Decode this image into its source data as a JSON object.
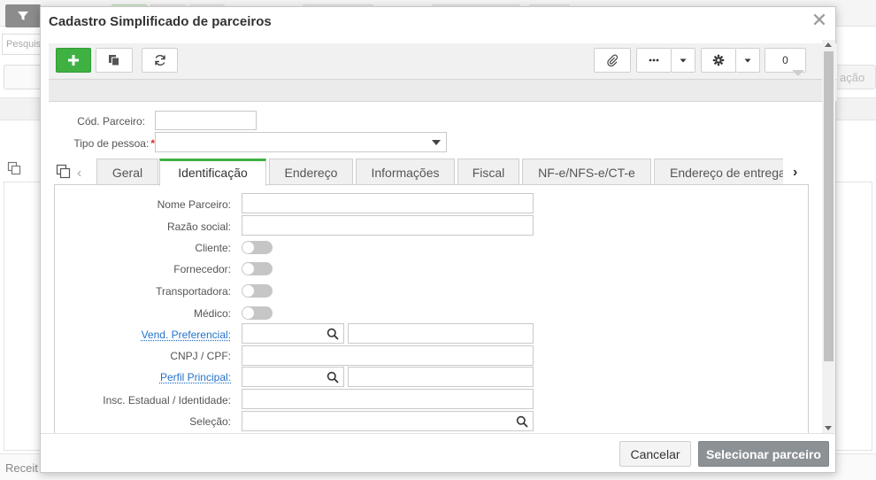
{
  "background": {
    "search_placeholder": "Pesquisar",
    "right_button_label": "ação",
    "footer_label": "Receit"
  },
  "modal": {
    "title": "Cadastro Simplificado de parceiros",
    "close_icon": "close-icon",
    "toolbar": {
      "add_icon": "plus-icon",
      "clone_icon": "clone-icon",
      "refresh_icon": "refresh-icon",
      "attach_icon": "paperclip-icon",
      "more_icon": "ellipsis-icon",
      "settings_icon": "gear-icon",
      "counter_value": "0"
    },
    "header_fields": {
      "cod_parceiro_label": "Cód. Parceiro:",
      "cod_parceiro_value": "",
      "tipo_pessoa_label": "Tipo de pessoa:",
      "tipo_pessoa_required": "*",
      "tipo_pessoa_value": ""
    },
    "tabs": [
      {
        "label": "Geral"
      },
      {
        "label": "Identificação",
        "active": true
      },
      {
        "label": "Endereço"
      },
      {
        "label": "Informações"
      },
      {
        "label": "Fiscal"
      },
      {
        "label": "NF-e/NFS-e/CT-e"
      },
      {
        "label": "Endereço de entrega"
      }
    ],
    "form": {
      "nome_parceiro_label": "Nome Parceiro:",
      "razao_social_label": "Razão social:",
      "cliente_label": "Cliente:",
      "cliente_on": false,
      "fornecedor_label": "Fornecedor:",
      "fornecedor_on": false,
      "transportadora_label": "Transportadora:",
      "transportadora_on": false,
      "medico_label": "Médico:",
      "medico_on": false,
      "vend_preferencial_label": "Vend. Preferencial:",
      "cnpj_cpf_label": "CNPJ / CPF:",
      "perfil_principal_label": "Perfil Principal:",
      "insc_estadual_label": "Insc. Estadual / Identidade:",
      "selecao_label": "Seleção:"
    },
    "footer": {
      "cancel_label": "Cancelar",
      "select_label": "Selecionar parceiro"
    }
  },
  "colors": {
    "accent_green": "#3fb143",
    "link_blue": "#2673c8",
    "required_red": "#d9302c",
    "primary_button_grey": "#8c9196"
  }
}
